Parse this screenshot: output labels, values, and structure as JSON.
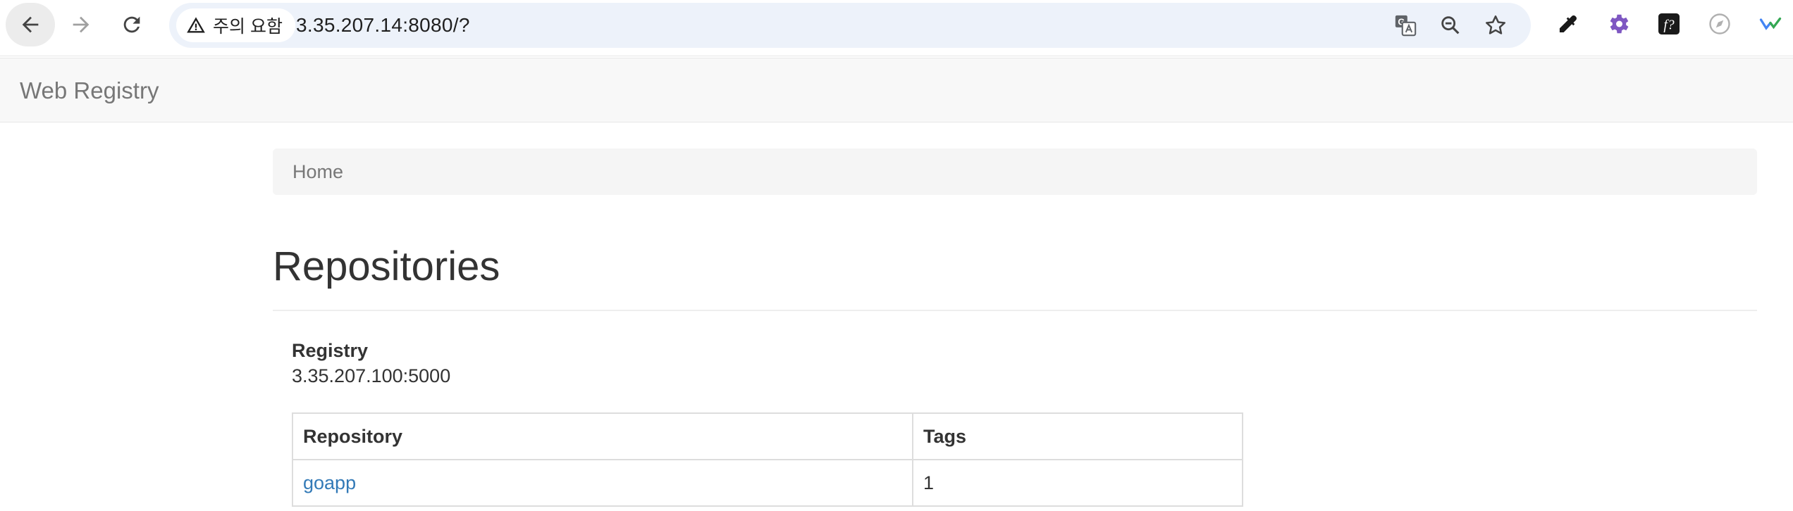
{
  "browser": {
    "security_chip_label": "주의 요함",
    "url": "3.35.207.14:8080/?",
    "icons": {
      "back": "arrow-left-icon",
      "forward": "arrow-right-icon",
      "reload": "reload-icon",
      "warning": "warning-triangle-icon",
      "translate": "translate-icon",
      "zoom": "zoom-out-icon",
      "bookmark": "star-icon",
      "extensions": [
        "eyedropper-icon",
        "gear-icon",
        "formula-icon",
        "compass-icon",
        "checkmark-icon"
      ]
    }
  },
  "navbar": {
    "brand": "Web Registry"
  },
  "breadcrumb": {
    "items": [
      "Home"
    ]
  },
  "main": {
    "title": "Repositories",
    "registry_label": "Registry",
    "registry_value": "3.35.207.100:5000",
    "table": {
      "headers": [
        "Repository",
        "Tags"
      ],
      "rows": [
        {
          "repository": "goapp",
          "tags": "1"
        }
      ]
    }
  },
  "colors": {
    "link": "#337ab7",
    "navbar_bg": "#f8f8f8",
    "omnibox_bg": "#edf2fa",
    "gear_purple": "#7e57c2",
    "check_blue": "#4285f4",
    "check_green": "#34a853"
  }
}
